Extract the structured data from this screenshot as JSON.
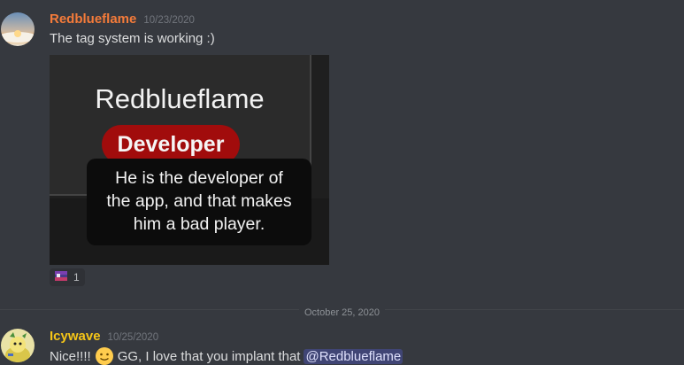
{
  "messages": [
    {
      "username": "Redblueflame",
      "username_color": "#f47b3a",
      "timestamp": "10/23/2020",
      "text": "The tag system is working  :)",
      "attachment": {
        "name": "Redblueflame",
        "badge": "Developer",
        "tooltip_lines": [
          "He is the developer of",
          "the app, and that makes",
          "him a bad player."
        ]
      },
      "reaction": {
        "emoji": "flag-icon",
        "count": "1"
      }
    },
    {
      "username": "Icywave",
      "username_color": "#f5c518",
      "timestamp": "10/25/2020",
      "text_before": "Nice!!!!",
      "emoji": "slightly-smiling-face-icon",
      "text_after": "GG, I love that you implant that",
      "mention": "@Redblueflame"
    }
  ],
  "divider": {
    "date": "October 25, 2020"
  },
  "colors": {
    "background": "#36393f",
    "badge_red": "#a10c0c",
    "mention_bg": "rgba(88,101,242,0.3)"
  }
}
